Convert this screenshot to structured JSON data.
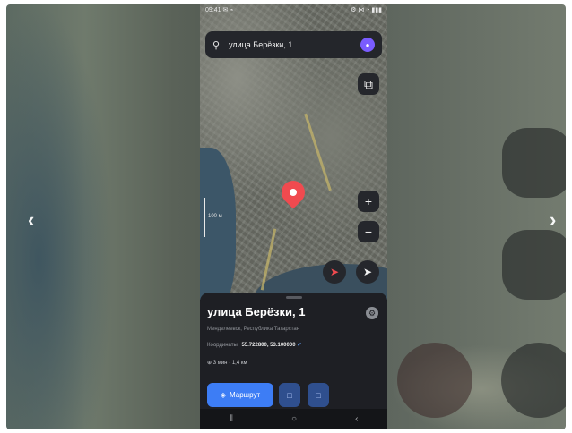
{
  "viewer": {
    "prev_label": "‹",
    "next_label": "›"
  },
  "status_bar": {
    "time": "09:41 ✉ ⌁",
    "icons": "⚙ ⋈ ◔ ▮▮▮"
  },
  "search": {
    "value": "улица Берёзки, 1",
    "search_icon": "search-icon",
    "assistant_icon": "assistant-icon"
  },
  "map": {
    "layers_icon": "⧉",
    "zoom_in_label": "+",
    "zoom_out_label": "−",
    "scale_label": "100 м",
    "pin_color": "#f04a4f"
  },
  "place_card": {
    "title": "улица Берёзки, 1",
    "subtitle": "Менделеевск, Республика Татарстан",
    "coords_label": "Координаты:",
    "coords_value": "55.722800, 53.100000",
    "distance": "⊕ 3 мин · 1,4 км",
    "route_label": "Маршрут",
    "route_icon": "route-icon",
    "action_1_icon": "□",
    "action_2_icon": "□",
    "accent_color": "#3d7df5"
  },
  "system_nav": {
    "recents": "⦀",
    "home": "○",
    "back": "‹"
  }
}
